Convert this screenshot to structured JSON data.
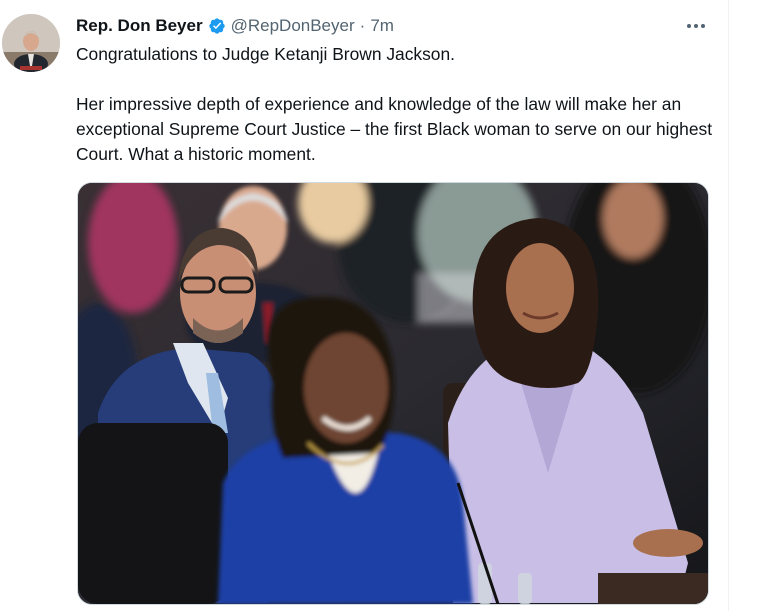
{
  "tweet": {
    "author": {
      "display_name": "Rep. Don Beyer",
      "handle": "@RepDonBeyer",
      "verified": true,
      "avatar_icon": "profile-photo"
    },
    "separator": "·",
    "timestamp": "7m",
    "more_icon": "more-options-icon",
    "text": {
      "line1": "Congratulations to Judge Ketanji Brown Jackson.",
      "paragraph2": "Her impressive depth of experience and knowledge of the law will make her an exceptional Supreme Court Justice – the first Black woman to serve on our highest Court. What a historic moment."
    }
  },
  "colors": {
    "text_primary": "#0f1419",
    "text_secondary": "#536471",
    "verified_blue": "#1d9bf0",
    "border": "#cfd9de"
  }
}
